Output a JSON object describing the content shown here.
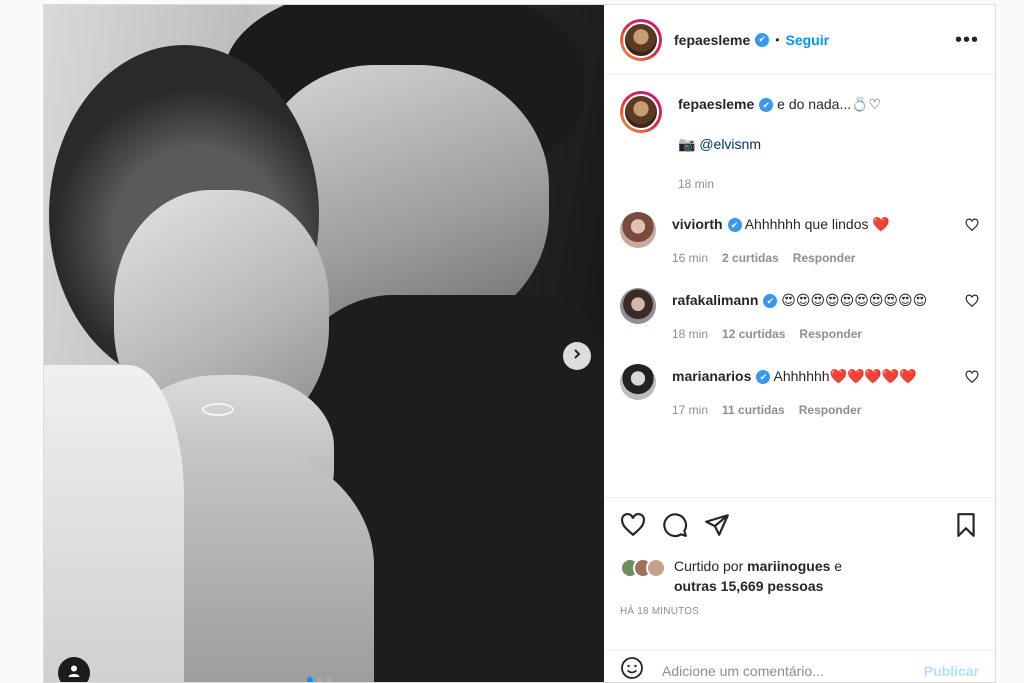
{
  "post": {
    "author": {
      "username": "fepaesleme",
      "verified": true,
      "follow_label": "Seguir",
      "separator": "•",
      "more_label": "•••"
    },
    "caption": {
      "text": "e do nada...💍♡",
      "photo_credit_icon": "📷",
      "photo_credit": "@elvisnm",
      "time": "18 min"
    },
    "comments": [
      {
        "username": "viviorth",
        "verified": true,
        "text": "Ahhhhhh que lindos ❤️",
        "time": "16 min",
        "replies": "2 curtidas",
        "reply_label": "Responder"
      },
      {
        "username": "rafakalimann",
        "verified": true,
        "text": "😍😍😍😍😍😍😍😍😍😍",
        "time": "18 min",
        "replies": "12 curtidas",
        "reply_label": "Responder"
      },
      {
        "username": "marianarios",
        "verified": true,
        "text": "Ahhhhhh❤️❤️❤️❤️❤️",
        "time": "17 min",
        "replies": "11 curtidas",
        "reply_label": "Responder"
      }
    ],
    "likes": {
      "prefix": "Curtido por",
      "user": "mariinogues",
      "connector": "e",
      "others": "outras 15,669 pessoas"
    },
    "posted_ago": "HÁ 18 MINUTOS",
    "comment_input": {
      "placeholder": "Adicione um comentário...",
      "publish_label": "Publicar"
    },
    "icons": {
      "like": "heart-icon",
      "comment": "comment-icon",
      "share": "share-icon",
      "save": "bookmark-icon",
      "emoji": "emoji-icon",
      "next": "chevron-right-icon",
      "tag": "user-tag-icon"
    },
    "colors": {
      "accent": "#0095f6",
      "verified": "#3897f0",
      "heart": "#ed4956"
    },
    "carousel": {
      "slides": 3,
      "active": 1
    }
  }
}
